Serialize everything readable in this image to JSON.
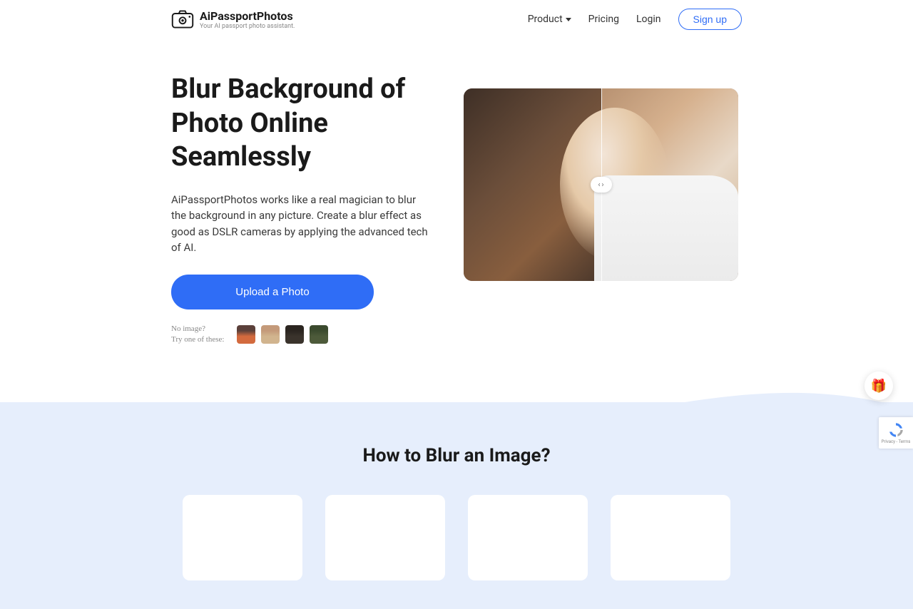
{
  "header": {
    "brand_name": "AiPassportPhotos",
    "brand_tagline": "Your AI passport photo assistant.",
    "nav": {
      "product": "Product",
      "pricing": "Pricing",
      "login": "Login",
      "signup": "Sign up"
    }
  },
  "hero": {
    "title": "Blur Background of Photo Online Seamlessly",
    "description": "AiPassportPhotos works like a real magician to blur the background in any picture. Create a blur effect as good as DSLR cameras by applying the advanced tech of AI.",
    "upload_label": "Upload a Photo",
    "samples": {
      "line1": "No image?",
      "line2": "Try one of these:"
    }
  },
  "steps": {
    "title": "How to Blur an Image?"
  },
  "gift_icon": "🎁",
  "recaptcha": {
    "line1": "Privacy",
    "line2": "Terms"
  }
}
